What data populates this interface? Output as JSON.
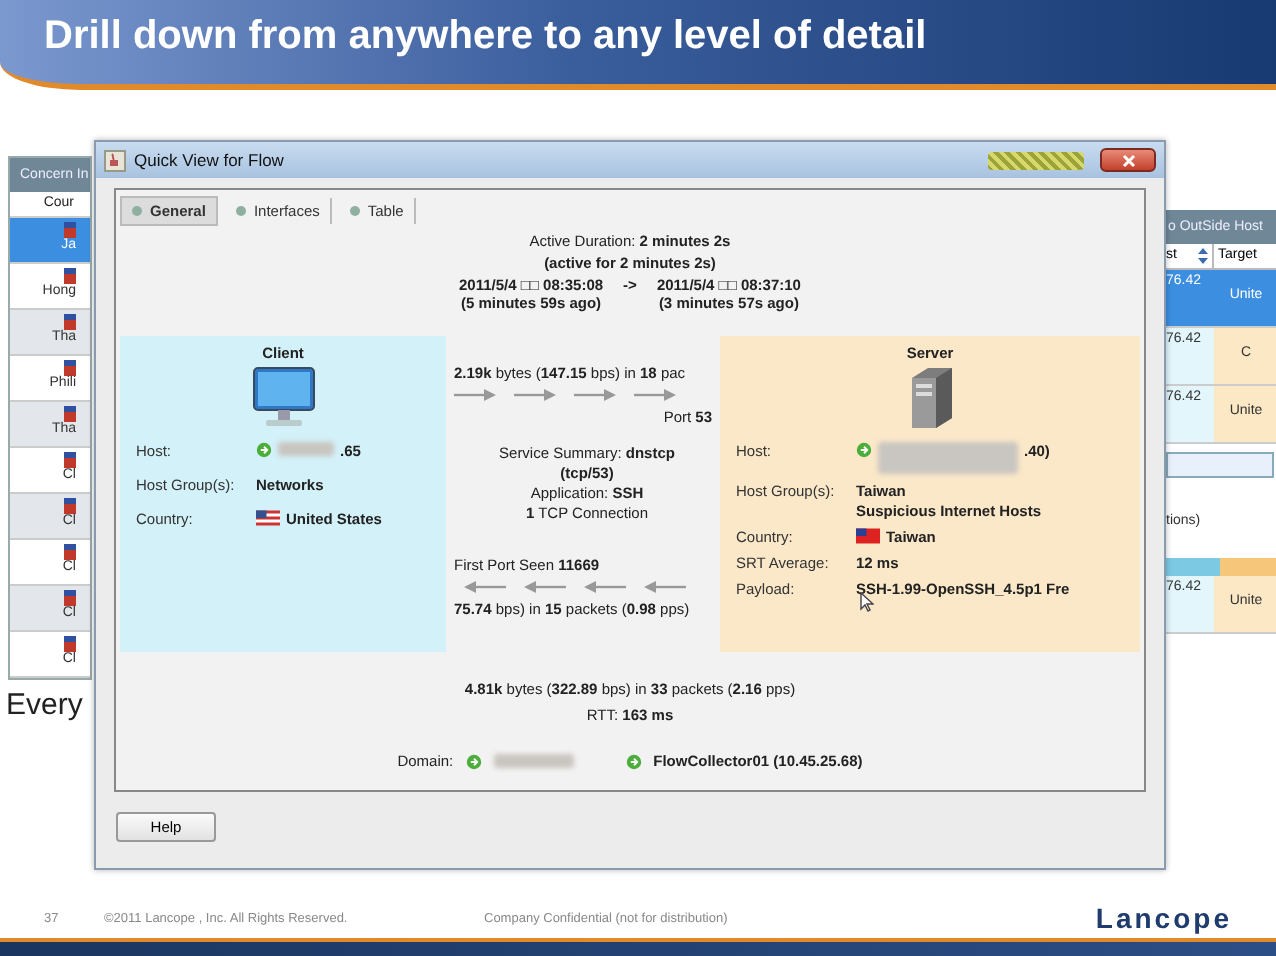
{
  "slide": {
    "title": "Drill down from anywhere to any level of detail",
    "caption": "Every"
  },
  "concern_window": {
    "title": "Concern In",
    "column": "Cour",
    "rows": [
      {
        "text": "Ja",
        "selected": true
      },
      {
        "text": "Hong",
        "selected": false
      },
      {
        "text": "Tha",
        "selected": false
      },
      {
        "text": "Phili",
        "selected": false
      },
      {
        "text": "Tha",
        "selected": false
      },
      {
        "text": "Cl",
        "selected": false
      },
      {
        "text": "Cl",
        "selected": false
      },
      {
        "text": "Cl",
        "selected": false
      },
      {
        "text": "Cl",
        "selected": false
      },
      {
        "text": "Cl",
        "selected": false
      }
    ]
  },
  "outside_window": {
    "title": "o OutSide Host",
    "columns": [
      {
        "label": "st",
        "sortable": true
      },
      {
        "label": "Target",
        "sortable": false
      }
    ],
    "rows": [
      {
        "cells": [
          "76.42",
          "Unite"
        ],
        "selected": true
      },
      {
        "cells": [
          "76.42",
          "C"
        ],
        "selected": false
      },
      {
        "cells": [
          "76.42",
          "Unite"
        ],
        "selected": false
      }
    ],
    "note": "tions)",
    "rows_after": [
      {
        "cells": [
          "76.42",
          "Unite"
        ],
        "selected": false
      }
    ]
  },
  "dialog": {
    "title": "Quick View for Flow",
    "tabs": [
      {
        "label": "General",
        "selected": true
      },
      {
        "label": "Interfaces",
        "selected": false
      },
      {
        "label": "Table",
        "selected": false
      }
    ],
    "duration": "Active Duration: **2 minutes 2s**",
    "active": "(active for 2 minutes 2s)",
    "start": "2011/5/4 □□ 08:35:08",
    "arrow": "->",
    "end": "2011/5/4 □□ 08:37:10",
    "start_ago": "(5 minutes 59s ago)",
    "end_ago": "(3 minutes 57s ago)",
    "client": {
      "heading": "Client",
      "fields": [
        {
          "kind": "host",
          "label": "Host:",
          "value": ".65",
          "redacted": true
        },
        {
          "kind": "text",
          "label": "Host Group(s):",
          "values": [
            "Networks"
          ]
        },
        {
          "kind": "country",
          "label": "Country:",
          "value": "United States"
        }
      ]
    },
    "server": {
      "heading": "Server",
      "fields": [
        {
          "kind": "host",
          "label": "Host:",
          "value": ".40)",
          "redacted": true
        },
        {
          "kind": "text",
          "label": "Host Group(s):",
          "values": [
            "Taiwan",
            "Suspicious Internet Hosts"
          ]
        },
        {
          "kind": "country",
          "label": "Country:",
          "value": "Taiwan"
        },
        {
          "kind": "text",
          "label": "SRT Average:",
          "values": [
            "12 ms"
          ]
        },
        {
          "kind": "payload",
          "label": "Payload:",
          "value": "SSH-1.99-OpenSSH_4.5p1 Fre"
        }
      ]
    },
    "outbound": "**2.19k** bytes (**147.15** bps) in **18** pac",
    "port": "Port **53**",
    "service": [
      "Service Summary: **dnstcp**",
      "**(tcp/53)**",
      "Application: **SSH**",
      "**1** TCP Connection"
    ],
    "first_port": "First Port Seen  **11669**",
    "inbound": "**75.74** bps) in **15** packets (**0.98** pps)",
    "totals": "**4.81k** bytes (**322.89** bps) in **33** packets (**2.16** pps)",
    "rtt": "RTT: **163 ms**",
    "domain_label": "Domain:",
    "collector": "FlowCollector01 (10.45.25.68)",
    "help": "Help"
  },
  "footer": {
    "page": "37",
    "copyright": "©2011 Lancope , Inc.  All Rights Reserved.",
    "notice": "Company Confidential (not for distribution)",
    "logo": "Lancope"
  }
}
